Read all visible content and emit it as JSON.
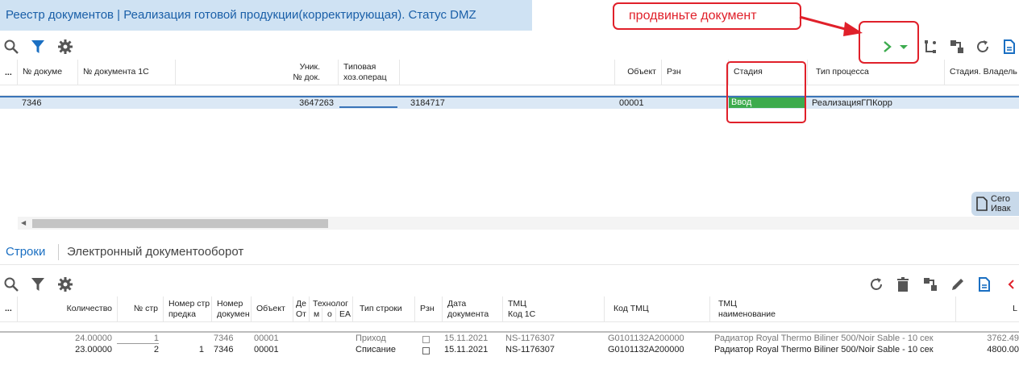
{
  "window": {
    "title": "Реестр документов | Реализация готовой продукции(корректирующая). Статус DMZ"
  },
  "annotation": {
    "callout_text": "продвиньте документ"
  },
  "toolbar": {
    "icons": [
      "search-icon",
      "filter-icon",
      "gear-icon",
      "advance-icon",
      "dropdown-icon",
      "route-icon",
      "transfer-icon",
      "refresh-icon",
      "document-icon"
    ]
  },
  "grid": {
    "columns": {
      "more": "...",
      "doc_num": "№ докуме",
      "doc_1c": "№ документа 1С",
      "uniq": "Уник.\n№ док.",
      "typical": "Типовая\nхоз.операц",
      "object": "Объект",
      "rzn": "Рзн",
      "stage": "Стадия",
      "process": "Тип процесса",
      "owner": "Стадия. Владель"
    },
    "row": {
      "doc_num": "7346",
      "uniq": "3647263",
      "typical2": "3184717",
      "object": "00001",
      "stage": "Ввод",
      "process": "РеализацияГПКорр"
    }
  },
  "side_note": {
    "line1": "Сего",
    "line2": "Ивак"
  },
  "tabs": {
    "rows": "Строки",
    "edo": "Электронный документооборот"
  },
  "grid2": {
    "columns": {
      "qty": "Количество",
      "line_no": "№ стр",
      "pred_line": "Номер стр\nпредка",
      "doc_num": "Номер\nдокумен",
      "object": "Объект",
      "de": "Де\nОт",
      "tech": "Технолог",
      "m": "м",
      "o": "о",
      "ea": "ЕА",
      "line_type": "Тип строки",
      "rzn": "Рзн",
      "doc_date": "Дата\nдокумента",
      "tmc_1c": "ТМЦ\nКод 1С",
      "tmc_code": "Код ТМЦ",
      "tmc_name": "ТМЦ\nнаименование",
      "last": "L"
    },
    "rows": [
      {
        "qty": "24.00000",
        "line_no": "1",
        "pred_line": "",
        "doc_num": "7346",
        "object": "00001",
        "line_type": "Приход",
        "doc_date": "15.11.2021",
        "tmc_1c": "NS-1176307",
        "tmc_code": "G0101132A200000",
        "tmc_name": "Радиатор Royal Thermo Biliner 500/Noir Sable - 10 сек",
        "last": "3762.49"
      },
      {
        "qty": "23.00000",
        "line_no": "2",
        "pred_line": "1",
        "doc_num": "7346",
        "object": "00001",
        "line_type": "Списание",
        "doc_date": "15.11.2021",
        "tmc_1c": "NS-1176307",
        "tmc_code": "G0101132A200000",
        "tmc_name": "Радиатор Royal Thermo Biliner 500/Noir Sable - 10 сек",
        "last": "4800.00"
      }
    ]
  },
  "toolbar2": {
    "icons": [
      "search-icon",
      "filter-icon",
      "gear-icon",
      "refresh-icon",
      "trash-icon",
      "transfer-icon",
      "pencil-icon",
      "document-icon",
      "back-icon"
    ]
  },
  "colors": {
    "accent": "#1a5fa8",
    "highlight": "#e0202a",
    "stage": "#3cab4e",
    "selection": "#dbe8f5"
  }
}
